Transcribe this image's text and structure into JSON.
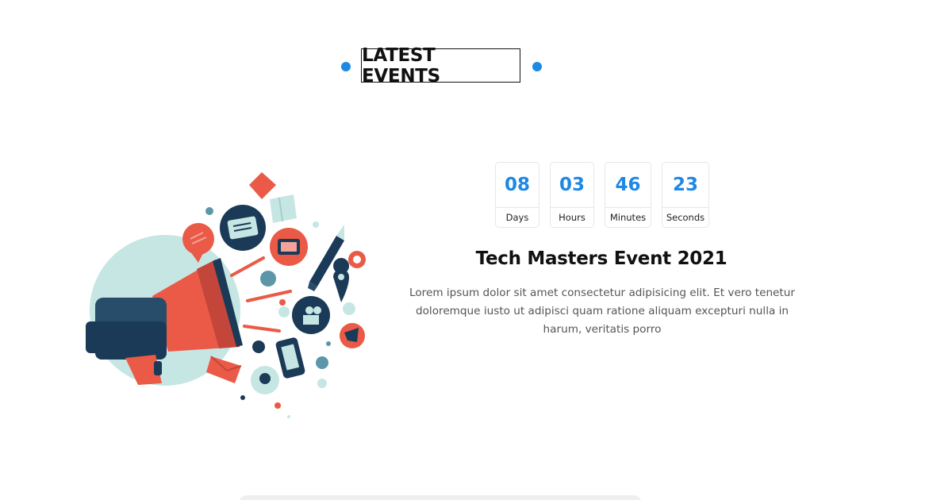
{
  "colors": {
    "accent_blue": "#1e88e5",
    "coral": "#ea5a47",
    "navy": "#1b3a57",
    "teal_light": "#c6e6e4"
  },
  "section": {
    "heading": "LATEST EVENTS"
  },
  "illustration": {
    "icon": "megaphone-marketing-illustration"
  },
  "countdown": [
    {
      "value": "08",
      "label": "Days"
    },
    {
      "value": "03",
      "label": "Hours"
    },
    {
      "value": "46",
      "label": "Minutes"
    },
    {
      "value": "23",
      "label": "Seconds"
    }
  ],
  "event": {
    "title": "Tech Masters Event 2021",
    "description": "Lorem ipsum dolor sit amet consectetur adipisicing elit. Et vero tenetur doloremque iusto ut adipisci quam ratione aliquam excepturi nulla in harum, veritatis porro"
  }
}
